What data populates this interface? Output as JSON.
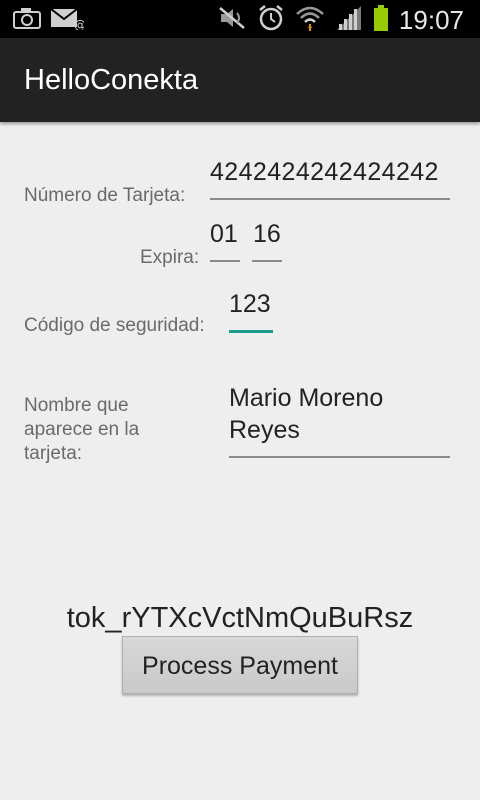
{
  "status_bar": {
    "time": "19:07",
    "left_icons": [
      "camera-icon",
      "mail-icon"
    ],
    "right_icons": [
      "mute-icon",
      "alarm-icon",
      "wifi-icon",
      "signal-icon",
      "battery-icon"
    ],
    "battery_color": "#99cc00"
  },
  "app": {
    "title": "HelloConekta"
  },
  "form": {
    "card_number_label": "Número de Tarjeta:",
    "card_number_value": "4242424242424242",
    "expires_label": "Expira:",
    "expires_month": "01",
    "expires_year": "16",
    "cvc_label": "Código de seguridad:",
    "cvc_value": "123",
    "name_label_line1": "Nombre que",
    "name_label_line2": "aparece en la",
    "name_label_line3": "tarjeta:",
    "name_value_line1": "Mario Moreno",
    "name_value_line2": "Reyes"
  },
  "result": {
    "token": "tok_rYTXcVctNmQuBuRsz"
  },
  "actions": {
    "process_label": "Process Payment"
  },
  "colors": {
    "accent_focus": "#1a9c8e",
    "action_bar": "#222222",
    "background": "#eeeeee"
  }
}
